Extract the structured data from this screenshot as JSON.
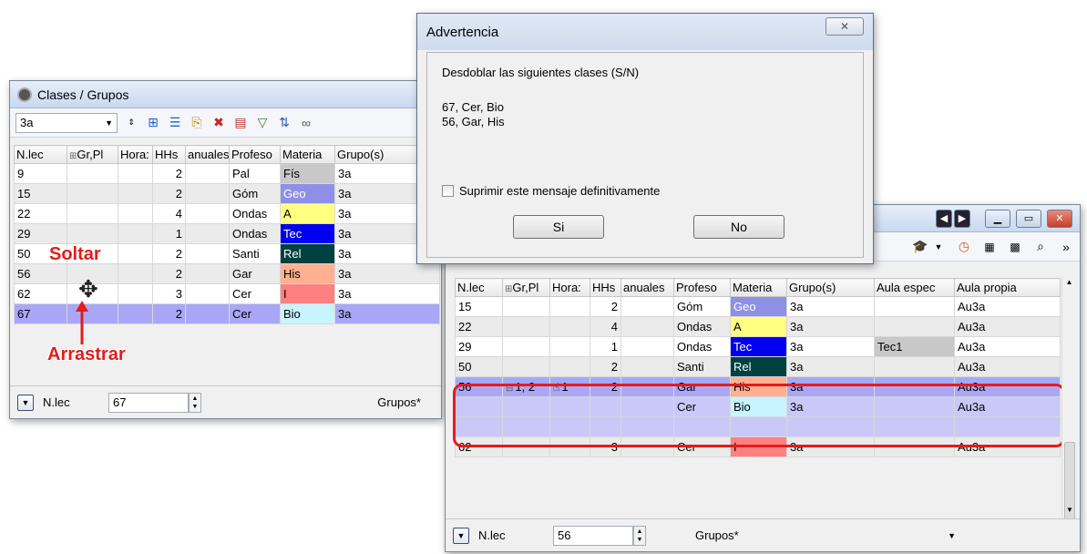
{
  "left_window": {
    "title": "Clases / Grupos",
    "combo_value": "3a",
    "columns": [
      "N.lec",
      "Gr,Pl",
      "Hora:",
      "HHs",
      "anuales",
      "Profeso",
      "Materia",
      "Grupo(s)"
    ],
    "rows": [
      {
        "nlec": "9",
        "grpl": "",
        "hora": "",
        "hhs": "2",
        "anuales": "",
        "prof": "Pal",
        "materia": "Fís",
        "materia_color": "#c8c8c8",
        "grupo": "3a"
      },
      {
        "nlec": "15",
        "grpl": "",
        "hora": "",
        "hhs": "2",
        "anuales": "",
        "prof": "Góm",
        "materia": "Geo",
        "materia_color": "#8f8fe8",
        "grupo": "3a"
      },
      {
        "nlec": "22",
        "grpl": "",
        "hora": "",
        "hhs": "4",
        "anuales": "",
        "prof": "Ondas",
        "materia": "A",
        "materia_color": "#ffff80",
        "grupo": "3a"
      },
      {
        "nlec": "29",
        "grpl": "",
        "hora": "",
        "hhs": "1",
        "anuales": "",
        "prof": "Ondas",
        "materia": "Tec",
        "materia_color": "#0000f0",
        "grupo": "3a"
      },
      {
        "nlec": "50",
        "grpl": "",
        "hora": "",
        "hhs": "2",
        "anuales": "",
        "prof": "Santi",
        "materia": "Rel",
        "materia_color": "#004040",
        "grupo": "3a"
      },
      {
        "nlec": "56",
        "grpl": "",
        "hora": "",
        "hhs": "2",
        "anuales": "",
        "prof": "Gar",
        "materia": "His",
        "materia_color": "#ffb090",
        "grupo": "3a"
      },
      {
        "nlec": "62",
        "grpl": "",
        "hora": "",
        "hhs": "3",
        "anuales": "",
        "prof": "Cer",
        "materia": "I",
        "materia_color": "#ff8080",
        "grupo": "3a"
      },
      {
        "nlec": "67",
        "grpl": "",
        "hora": "",
        "hhs": "2",
        "anuales": "",
        "prof": "Cer",
        "materia": "Bio",
        "materia_color": "#c8f4ff",
        "grupo": "3a"
      }
    ],
    "footer_label": "N.lec",
    "footer_value": "67",
    "footer_select": "Grupos*"
  },
  "annotations": {
    "drop_label": "Soltar",
    "drag_label": "Arrastrar"
  },
  "dialog": {
    "title": "Advertencia",
    "message": "Desdoblar las siguientes clases (S/N)",
    "line1": "67, Cer, Bio",
    "line2": "56, Gar, His",
    "checkbox_label": "Suprimir este mensaje definitivamente",
    "yes_label": "Si",
    "no_label": "No"
  },
  "right_window": {
    "columns": [
      "N.lec",
      "Gr,Pl",
      "Hora:",
      "HHs",
      "anuales",
      "Profeso",
      "Materia",
      "Grupo(s)",
      "Aula espec",
      "Aula propia"
    ],
    "rows": [
      {
        "nlec": "15",
        "grpl": "",
        "hora": "",
        "hhs": "2",
        "prof": "Góm",
        "materia": "Geo",
        "materia_color": "#8f8fe8",
        "grupo": "3a",
        "aula_espec": "",
        "aula_propia": "Au3a"
      },
      {
        "nlec": "22",
        "grpl": "",
        "hora": "",
        "hhs": "4",
        "prof": "Ondas",
        "materia": "A",
        "materia_color": "#ffff80",
        "grupo": "3a",
        "aula_espec": "",
        "aula_propia": "Au3a"
      },
      {
        "nlec": "29",
        "grpl": "",
        "hora": "",
        "hhs": "1",
        "prof": "Ondas",
        "materia": "Tec",
        "materia_color": "#0000f0",
        "grupo": "3a",
        "aula_espec": "Tec1",
        "aula_propia": "Au3a"
      },
      {
        "nlec": "50",
        "grpl": "",
        "hora": "",
        "hhs": "2",
        "prof": "Santi",
        "materia": "Rel",
        "materia_color": "#004040",
        "grupo": "3a",
        "aula_espec": "",
        "aula_propia": "Au3a"
      },
      {
        "nlec": "56",
        "grpl": "1, 2",
        "hora": "1",
        "hhs": "2",
        "prof": "Gar",
        "materia": "His",
        "materia_color": "#ffb090",
        "grupo": "3a",
        "aula_espec": "",
        "aula_propia": "Au3a"
      },
      {
        "nlec": "",
        "grpl": "",
        "hora": "",
        "hhs": "",
        "prof": "Cer",
        "materia": "Bio",
        "materia_color": "#c8f4ff",
        "grupo": "3a",
        "aula_espec": "",
        "aula_propia": "Au3a"
      },
      {
        "nlec": "",
        "grpl": "",
        "hora": "",
        "hhs": "",
        "prof": "",
        "materia": "",
        "materia_color": "",
        "grupo": "",
        "aula_espec": "",
        "aula_propia": ""
      },
      {
        "nlec": "62",
        "grpl": "",
        "hora": "",
        "hhs": "3",
        "prof": "Cer",
        "materia": "I",
        "materia_color": "#ff8080",
        "grupo": "3a",
        "aula_espec": "",
        "aula_propia": "Au3a"
      }
    ],
    "footer_label": "N.lec",
    "footer_value": "56",
    "footer_select": "Grupos*"
  }
}
